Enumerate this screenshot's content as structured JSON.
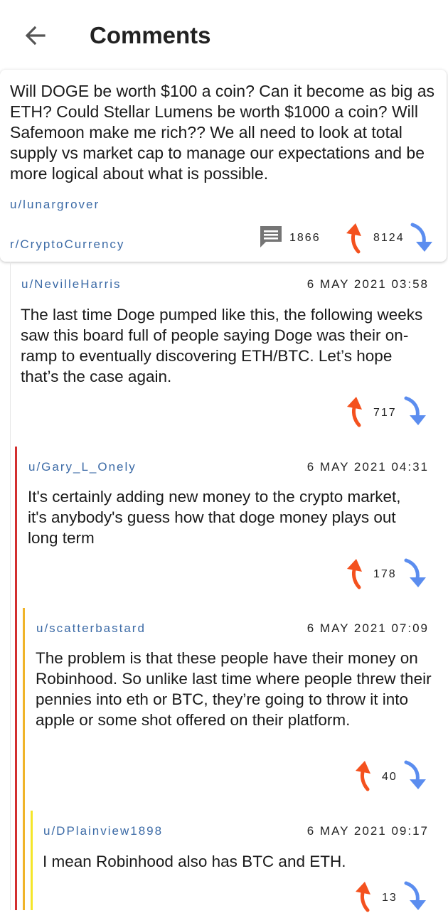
{
  "header": {
    "title": "Comments"
  },
  "post": {
    "text": "Will DOGE be worth $100 a coin? Can it become as big as ETH? Could Stellar Lumens be worth $1000 a coin? Will Safemoon make me rich?? We all need to look at total supply vs market cap to manage our expectations and be more logical about what is possible.",
    "author": "u/lunargrover",
    "subreddit": "r/CryptoCurrency",
    "comment_count": "1866",
    "score": "8124"
  },
  "comments": [
    {
      "user": "u/NevilleHarris",
      "date": "6 MAY 2021 03:58",
      "body": "The last time Doge pumped like this, the following weeks saw this board full of people saying Doge was their on-ramp to eventually discovering ETH/BTC. Let’s hope that’s the case again.",
      "score": "717"
    },
    {
      "user": "u/Gary_L_Onely",
      "date": "6 MAY 2021 04:31",
      "body": "It's certainly adding new money to the crypto market, it's anybody's guess how that doge money plays out long term",
      "score": "178"
    },
    {
      "user": "u/scatterbastard",
      "date": "6 MAY 2021 07:09",
      "body": "The problem is that these people have their money on Robinhood. So unlike last time where people threw their pennies into eth or BTC, they’re going to throw it into apple or some shot offered on their platform.",
      "score": "40"
    },
    {
      "user": "u/DPlainview1898",
      "date": "6 MAY 2021 09:17",
      "body": "I mean Robinhood also has BTC and ETH.",
      "score": "13"
    }
  ],
  "icons": {
    "back": "arrow-left-icon",
    "comments": "comment-icon",
    "upvote": "upvote-arrow-icon",
    "downvote": "downvote-arrow-icon"
  },
  "colors": {
    "upvote": "#f4511e",
    "downvote": "#5b8def",
    "link": "#3b6aa6",
    "thread_level_1": "#d32f2f",
    "thread_level_2": "#f0b429",
    "thread_level_3": "#f5e629"
  }
}
